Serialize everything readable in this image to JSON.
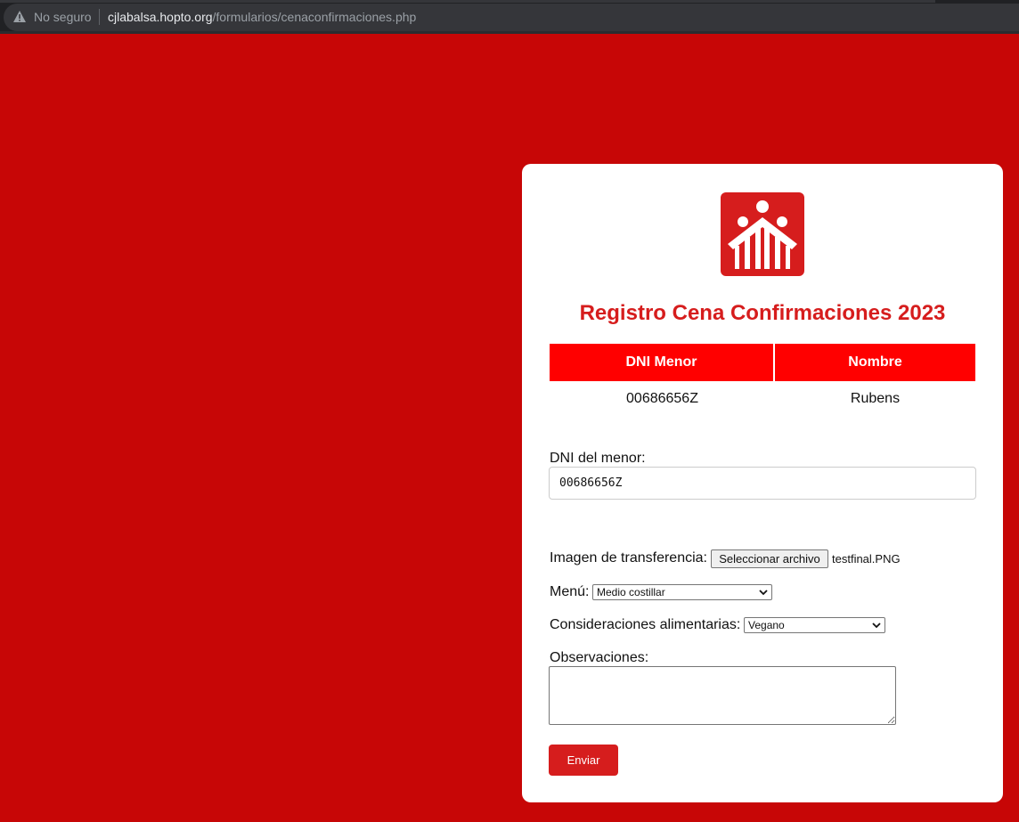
{
  "browser": {
    "security_label": "No seguro",
    "url_host": "cjlabalsa.hopto.org",
    "url_path": "/formularios/cenaconfirmaciones.php"
  },
  "form": {
    "title": "Registro Cena Confirmaciones 2023",
    "table": {
      "headers": [
        "DNI Menor",
        "Nombre"
      ],
      "rows": [
        [
          "00686656Z",
          "Rubens"
        ]
      ]
    },
    "dni_label": "DNI del menor:",
    "dni_value": "00686656Z",
    "image_label": "Imagen de transferencia:",
    "file_button_label": "Seleccionar archivo",
    "file_name": "testfinal.PNG",
    "menu_label": "Menú:",
    "menu_selected": "Medio costillar",
    "diet_label": "Consideraciones alimentarias:",
    "diet_selected": "Vegano",
    "notes_label": "Observaciones:",
    "notes_value": "",
    "submit_label": "Enviar"
  },
  "colors": {
    "page_background": "#c70606",
    "accent": "#d61d1d",
    "table_header": "#ff0000"
  },
  "icons": {
    "warning": "warning-triangle-icon",
    "logo": "figures-logo",
    "select_chevron": "chevron-down-icon"
  }
}
